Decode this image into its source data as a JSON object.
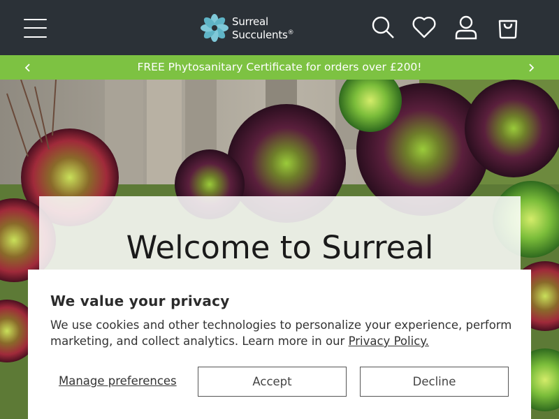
{
  "header": {
    "brand": {
      "line1": "Surreal",
      "line2": "Succulents",
      "mark": "®"
    },
    "icons": {
      "menu": "hamburger-menu-icon",
      "search": "search-icon",
      "wishlist": "heart-icon",
      "account": "user-icon",
      "cart": "shopping-bag-icon"
    },
    "colors": {
      "background": "#2b3137",
      "foreground": "#ffffff"
    }
  },
  "announcement": {
    "text": "FREE Phytosanitary Certificate for orders over £200!",
    "background": "#7dc242"
  },
  "hero": {
    "title": "Welcome to Surreal"
  },
  "cookie_banner": {
    "title": "We value your privacy",
    "body": "We use cookies and other technologies to personalize your experience, perform marketing, and collect analytics. Learn more in our ",
    "link_label": "Privacy Policy.",
    "manage_label": "Manage preferences",
    "accept_label": "Accept",
    "decline_label": "Decline"
  }
}
